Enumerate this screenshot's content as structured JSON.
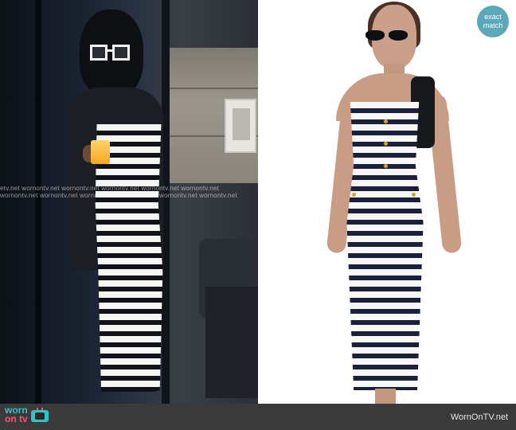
{
  "badge": {
    "line1": "exact",
    "line2": "match"
  },
  "watermark": {
    "row1": "etv.net wornontv.net wornontv.net wornontv.net wornontv.net wornontv.net",
    "row2": "wornontv.net wornontv.net wornontv.net wornontv.net wornontv.net wornontv.net"
  },
  "footer": {
    "logo_line1": "worn",
    "logo_line2": "on tv",
    "url": "WornOnTV.net"
  },
  "icons": {
    "tv": "tv-icon",
    "sunglasses": "sunglasses-icon"
  }
}
